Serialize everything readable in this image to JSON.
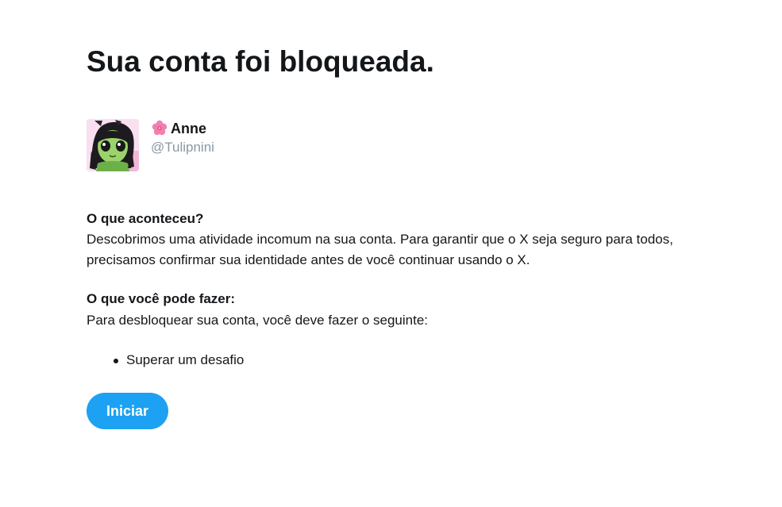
{
  "page": {
    "title": "Sua conta foi bloqueada."
  },
  "account": {
    "name": "Anne",
    "handle": "@Tulipnini",
    "name_emoji": "cherry-blossom-icon",
    "avatar": "avatar-image"
  },
  "what_happened": {
    "heading": "O que aconteceu?",
    "text": "Descobrimos uma atividade incomum na sua conta. Para garantir que o X seja seguro para todos, precisamos confirmar sua identidade antes de você continuar usando o X."
  },
  "what_you_can_do": {
    "heading": "O que você pode fazer:",
    "text": "Para desbloquear sua conta, você deve fazer o seguinte:",
    "steps": [
      {
        "label": "Superar um desafio"
      }
    ]
  },
  "actions": {
    "start_label": "Iniciar"
  },
  "colors": {
    "primary": "#1da1f2",
    "text": "#14171a",
    "muted": "#8899a6",
    "background": "#ffffff"
  }
}
